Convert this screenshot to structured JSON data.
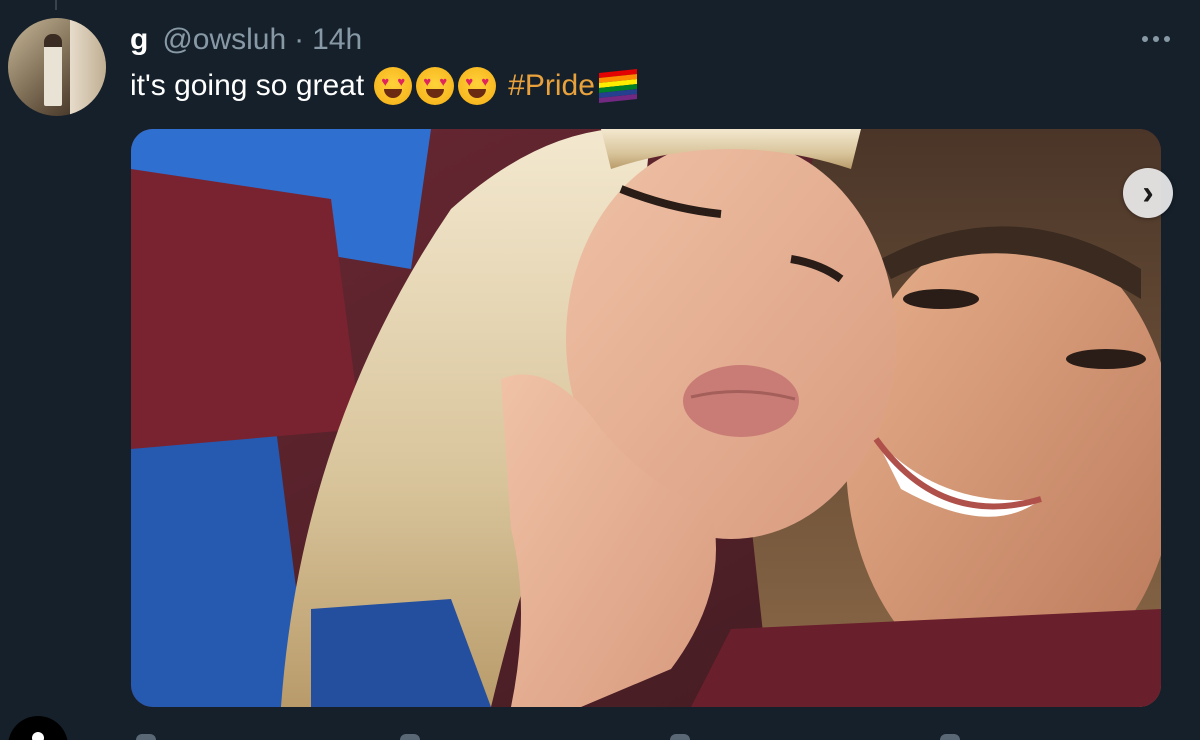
{
  "tweet": {
    "display_name": "g",
    "handle": "@owsluh",
    "separator": "·",
    "time": "14h",
    "text": "it's going so great",
    "emojis": [
      "smiling-face-with-heart-eyes",
      "smiling-face-with-heart-eyes",
      "smiling-face-with-heart-eyes"
    ],
    "hashtag": "#Pride",
    "flag_icon": "rainbow-flag",
    "more_icon": "more-horizontal-icon",
    "media_next_icon": "chevron-right-icon"
  },
  "colors": {
    "background": "#15202b",
    "secondary_text": "#8899a6",
    "hashtag": "#e9a23b",
    "flag_stripes": [
      "#e40303",
      "#ff8c00",
      "#ffed00",
      "#008026",
      "#24408e",
      "#732982"
    ]
  }
}
